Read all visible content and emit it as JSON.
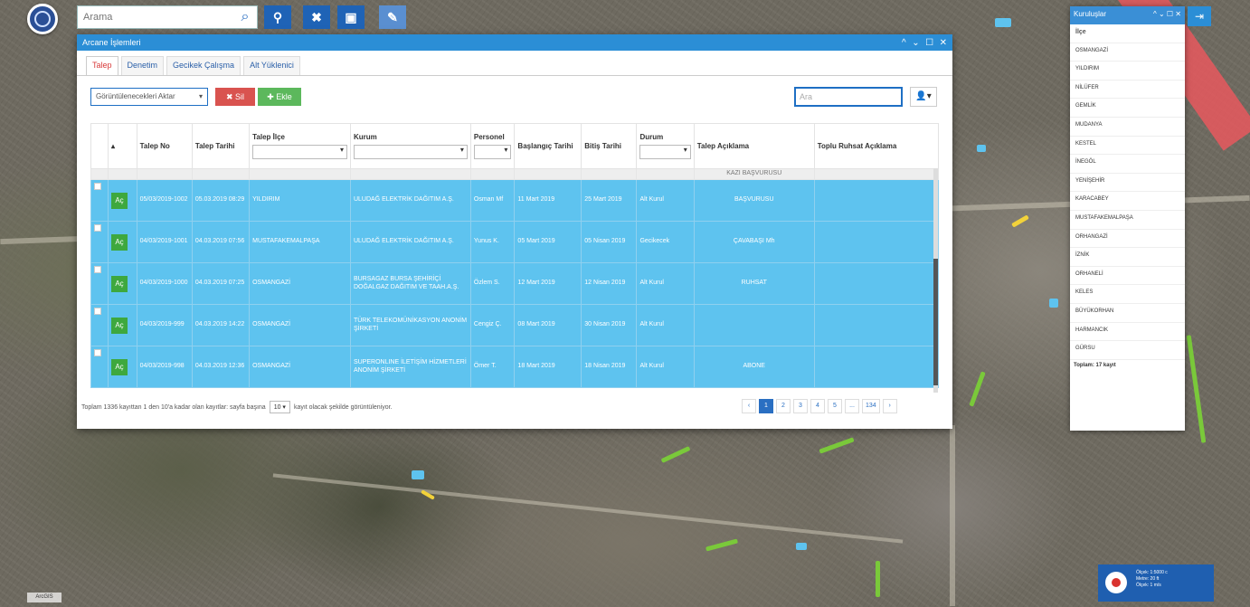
{
  "search": {
    "placeholder": "Arama"
  },
  "window": {
    "title": "Arcane İşlemleri",
    "controls": [
      "^",
      "⌄",
      "☐",
      "✕"
    ]
  },
  "tabs": [
    {
      "label": "Talep",
      "active": true
    },
    {
      "label": "Denetim",
      "active": false
    },
    {
      "label": "Gecikek Çalışma",
      "active": false
    },
    {
      "label": "Alt Yüklenici",
      "active": false
    }
  ],
  "toolbar": {
    "select_label": "Görüntülenecekleri Aktar",
    "delete_label": "✖ Sil",
    "add_label": "✚ Ekle",
    "search_placeholder": "Ara",
    "user_menu_label": "👤▾"
  },
  "table": {
    "columns": [
      {
        "label": "",
        "filter": false
      },
      {
        "label": "▴",
        "filter": false
      },
      {
        "label": "Talep No",
        "filter": false
      },
      {
        "label": "Talep Tarihi",
        "filter": false
      },
      {
        "label": "Talep İlçe",
        "filter": true
      },
      {
        "label": "Kurum",
        "filter": true
      },
      {
        "label": "Personel",
        "filter": true
      },
      {
        "label": "Başlangıç Tarihi",
        "filter": false
      },
      {
        "label": "Bitiş Tarihi",
        "filter": false
      },
      {
        "label": "Durum",
        "filter": true
      },
      {
        "label": "Talep Açıklama",
        "filter": false
      },
      {
        "label": "Toplu Ruhsat Açıklama",
        "filter": false
      }
    ],
    "cut_row_text": "KAZI BAŞVURUSU",
    "action_label": "Aç",
    "rows": [
      {
        "no": "05/03/2019-1002",
        "date": "05.03.2019 08:29",
        "district": "YILDIRIM",
        "org": "ULUDAĞ ELEKTRİK DAĞITIM A.Ş.",
        "person": "Osman Mf",
        "start": "11 Mart 2019",
        "end": "25 Mart 2019",
        "status": "Alt Kurul",
        "desc": "BAŞVURUSU",
        "bulk": ""
      },
      {
        "no": "04/03/2019-1001",
        "date": "04.03.2019 07:56",
        "district": "MUSTAFAKEMALPAŞA",
        "org": "ULUDAĞ ELEKTRİK DAĞITIM A.Ş.",
        "person": "Yunus K.",
        "start": "05 Mart 2019",
        "end": "05 Nisan 2019",
        "status": "Gecikecek",
        "desc": "ÇAVABAŞI Mh",
        "bulk": ""
      },
      {
        "no": "04/03/2019-1000",
        "date": "04.03.2019 07:25",
        "district": "OSMANGAZİ",
        "org": "BURSAGAZ BURSA ŞEHİRİÇİ DOĞALGAZ DAĞITIM VE TAAH.A.Ş.",
        "person": "Özlem S.",
        "start": "12 Mart 2019",
        "end": "12 Nisan 2019",
        "status": "Alt Kurul",
        "desc": "RUHSAT",
        "bulk": ""
      },
      {
        "no": "04/03/2019-999",
        "date": "04.03.2019 14:22",
        "district": "OSMANGAZİ",
        "org": "TÜRK TELEKOMÜNİKASYON ANONİM ŞİRKETİ",
        "person": "Cengiz Ç.",
        "start": "08 Mart 2019",
        "end": "30 Nisan 2019",
        "status": "Alt Kurul",
        "desc": "",
        "bulk": ""
      },
      {
        "no": "04/03/2019-998",
        "date": "04.03.2019 12:36",
        "district": "OSMANGAZİ",
        "org": "SUPERONLINE İLETİŞİM HİZMETLERİ ANONİM ŞİRKETİ",
        "person": "Ömer T.",
        "start": "18 Mart 2019",
        "end": "18 Nisan 2019",
        "status": "Alt Kurul",
        "desc": "ABONE",
        "bulk": ""
      }
    ]
  },
  "footer": {
    "text_before": "Toplam 1336 kayıttan 1 den 10'a kadar olan kayıtlar: sayfa başına",
    "per_page": "10 ▾",
    "text_after": "kayıt olacak şekilde görüntüleniyor."
  },
  "pagination": [
    "‹",
    "1",
    "2",
    "3",
    "4",
    "5",
    "...",
    "134",
    "›"
  ],
  "pagination_active": "1",
  "district_panel": {
    "title": "Kuruluşlar",
    "controls": "^ ⌄ ☐ ✕",
    "header": "İlçe",
    "items": [
      "OSMANGAZİ",
      "YILDIRIM",
      "NİLÜFER",
      "GEMLİK",
      "MUDANYA",
      "KESTEL",
      "İNEGÖL",
      "YENİŞEHİR",
      "KARACABEY",
      "MUSTAFAKEMALPAŞA",
      "ORHANGAZİ",
      "İZNİK",
      "ORHANELİ",
      "KELES",
      "BÜYÜKORHAN",
      "HARMANCIK",
      "GÜRSU"
    ],
    "total": "Toplam: 17 kayıt"
  },
  "scale": {
    "line1": "Ölçek: 1:5000 c",
    "line2": "Metre: 20 ft",
    "line3": "Ölçek: 1 m/s"
  },
  "map_credit": "ArcGIS",
  "icons": {
    "logo": "logo-icon",
    "search": "search-icon",
    "location": "location-pin-icon",
    "tools": "tools-icon",
    "document": "document-icon",
    "draw": "draw-icon",
    "exit": "exit-icon"
  }
}
